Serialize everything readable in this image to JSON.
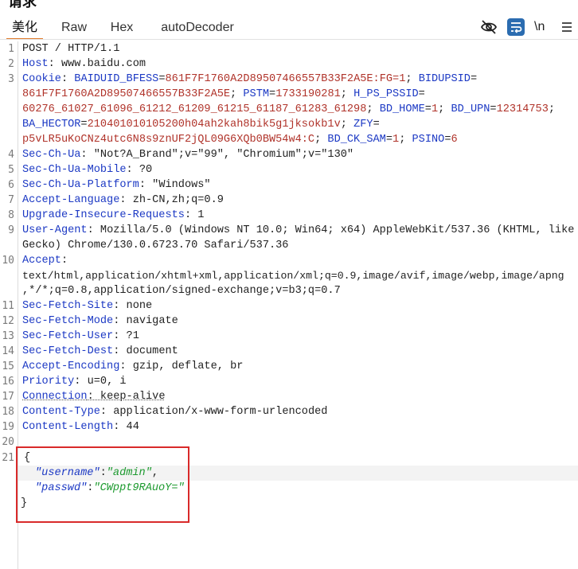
{
  "panel_title": "请求",
  "tabs": [
    {
      "label": "美化",
      "active": true
    },
    {
      "label": "Raw",
      "active": false
    },
    {
      "label": "Hex",
      "active": false
    },
    {
      "label": "autoDecoder",
      "active": false
    }
  ],
  "toolbar": {
    "hide_icon": "eye-off-icon",
    "wrap_icon": "wrap-text-icon",
    "newline_label": "\\n",
    "menu_icon": "menu-icon"
  },
  "request": {
    "line1": "POST / HTTP/1.1",
    "host_key": "Host",
    "host_val": "www.baidu.com",
    "cookie_key": "Cookie",
    "cookie": [
      {
        "k": "BAIDUID_BFESS",
        "v": "861F7F1760A2D89507466557B33F2A5E:FG=1"
      },
      {
        "k": "BIDUPSID",
        "v": "861F7F1760A2D89507466557B33F2A5E"
      },
      {
        "k": "PSTM",
        "v": "1733190281"
      },
      {
        "k": "H_PS_PSSID",
        "v": "60276_61027_61096_61212_61209_61215_61187_61283_61298"
      },
      {
        "k": "BD_HOME",
        "v": "1"
      },
      {
        "k": "BD_UPN",
        "v": "12314753"
      },
      {
        "k": "BA_HECTOR",
        "v": "210401010105200h04ah2kah8bik5g1jksokb1v"
      },
      {
        "k": "ZFY",
        "v": "p5vLR5uKoCNz4utc6N8s9znUF2jQL09G6XQb0BW54w4:C"
      },
      {
        "k": "BD_CK_SAM",
        "v": "1"
      },
      {
        "k": "PSINO",
        "v": "6"
      }
    ],
    "headers": {
      "sec_ch_ua_key": "Sec-Ch-Ua",
      "sec_ch_ua_val": "\"Not?A_Brand\";v=\"99\", \"Chromium\";v=\"130\"",
      "sec_ch_ua_mobile_key": "Sec-Ch-Ua-Mobile",
      "sec_ch_ua_mobile_val": "?0",
      "sec_ch_ua_platform_key": "Sec-Ch-Ua-Platform",
      "sec_ch_ua_platform_val": "\"Windows\"",
      "accept_language_key": "Accept-Language",
      "accept_language_val": "zh-CN,zh;q=0.9",
      "upgrade_key": "Upgrade-Insecure-Requests",
      "upgrade_val": "1",
      "user_agent_key": "User-Agent",
      "user_agent_val_1": "Mozilla/5.0 (Windows NT 10.0; Win64; x64) AppleWebKit/537.36 (KHTML, like",
      "user_agent_val_2": "Gecko) Chrome/130.0.6723.70 Safari/537.36",
      "accept_key": "Accept",
      "accept_val_1": "text/html,application/xhtml+xml,application/xml;q=0.9,image/avif,image/webp,image/apng",
      "accept_val_2": ",*/*;q=0.8,application/signed-exchange;v=b3;q=0.7",
      "sec_fetch_site_key": "Sec-Fetch-Site",
      "sec_fetch_site_val": "none",
      "sec_fetch_mode_key": "Sec-Fetch-Mode",
      "sec_fetch_mode_val": "navigate",
      "sec_fetch_user_key": "Sec-Fetch-User",
      "sec_fetch_user_val": "?1",
      "sec_fetch_dest_key": "Sec-Fetch-Dest",
      "sec_fetch_dest_val": "document",
      "accept_encoding_key": "Accept-Encoding",
      "accept_encoding_val": "gzip, deflate, br",
      "priority_key": "Priority",
      "priority_val": "u=0, i",
      "connection_key": "Connection",
      "connection_val": "keep-alive",
      "content_type_key": "Content-Type",
      "content_type_val": "application/x-www-form-urlencoded",
      "content_length_key": "Content-Length",
      "content_length_val": "44"
    },
    "body": {
      "open": "{",
      "username_key": "\"username\"",
      "username_val": "\"admin\"",
      "passwd_key": "\"passwd\"",
      "passwd_val": "\"CWppt9RAuoY=\"",
      "close": "}"
    }
  },
  "line_numbers": [
    "1",
    "2",
    "3",
    "4",
    "5",
    "6",
    "7",
    "8",
    "9",
    "10",
    "11",
    "12",
    "13",
    "14",
    "15",
    "16",
    "17",
    "18",
    "19",
    "20",
    "21"
  ]
}
